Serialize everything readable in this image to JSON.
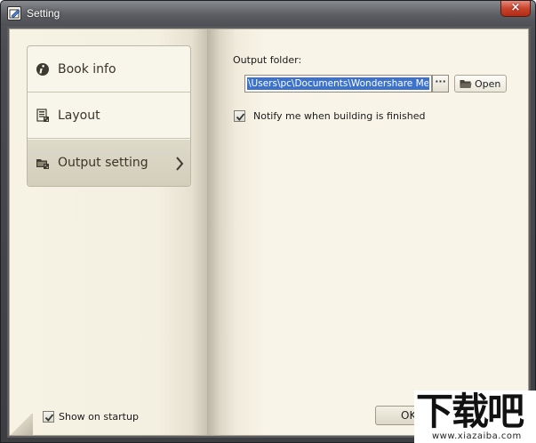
{
  "window": {
    "title": "Setting",
    "close_label": "×"
  },
  "nav": {
    "items": [
      {
        "label": "Book info",
        "icon": "info-icon",
        "active": false
      },
      {
        "label": "Layout",
        "icon": "layout-icon",
        "active": false
      },
      {
        "label": "Output setting",
        "icon": "output-icon",
        "active": true
      }
    ]
  },
  "output": {
    "folder_label": "Output folder:",
    "path_value": "\\Users\\pc\\Documents\\Wondershare MePub",
    "browse_label": "···",
    "open_label": "Open",
    "notify_label": "Notify me when building is finished",
    "notify_checked": true
  },
  "footer": {
    "show_on_startup_label": "Show on startup",
    "show_on_startup_checked": true,
    "ok_label": "OK"
  },
  "watermark": {
    "logo_text": "下载吧",
    "url": "www.xiazaiba.com"
  },
  "colors": {
    "page": "#f8f4e7",
    "selection": "#3c72c9",
    "close": "#c7442d"
  }
}
